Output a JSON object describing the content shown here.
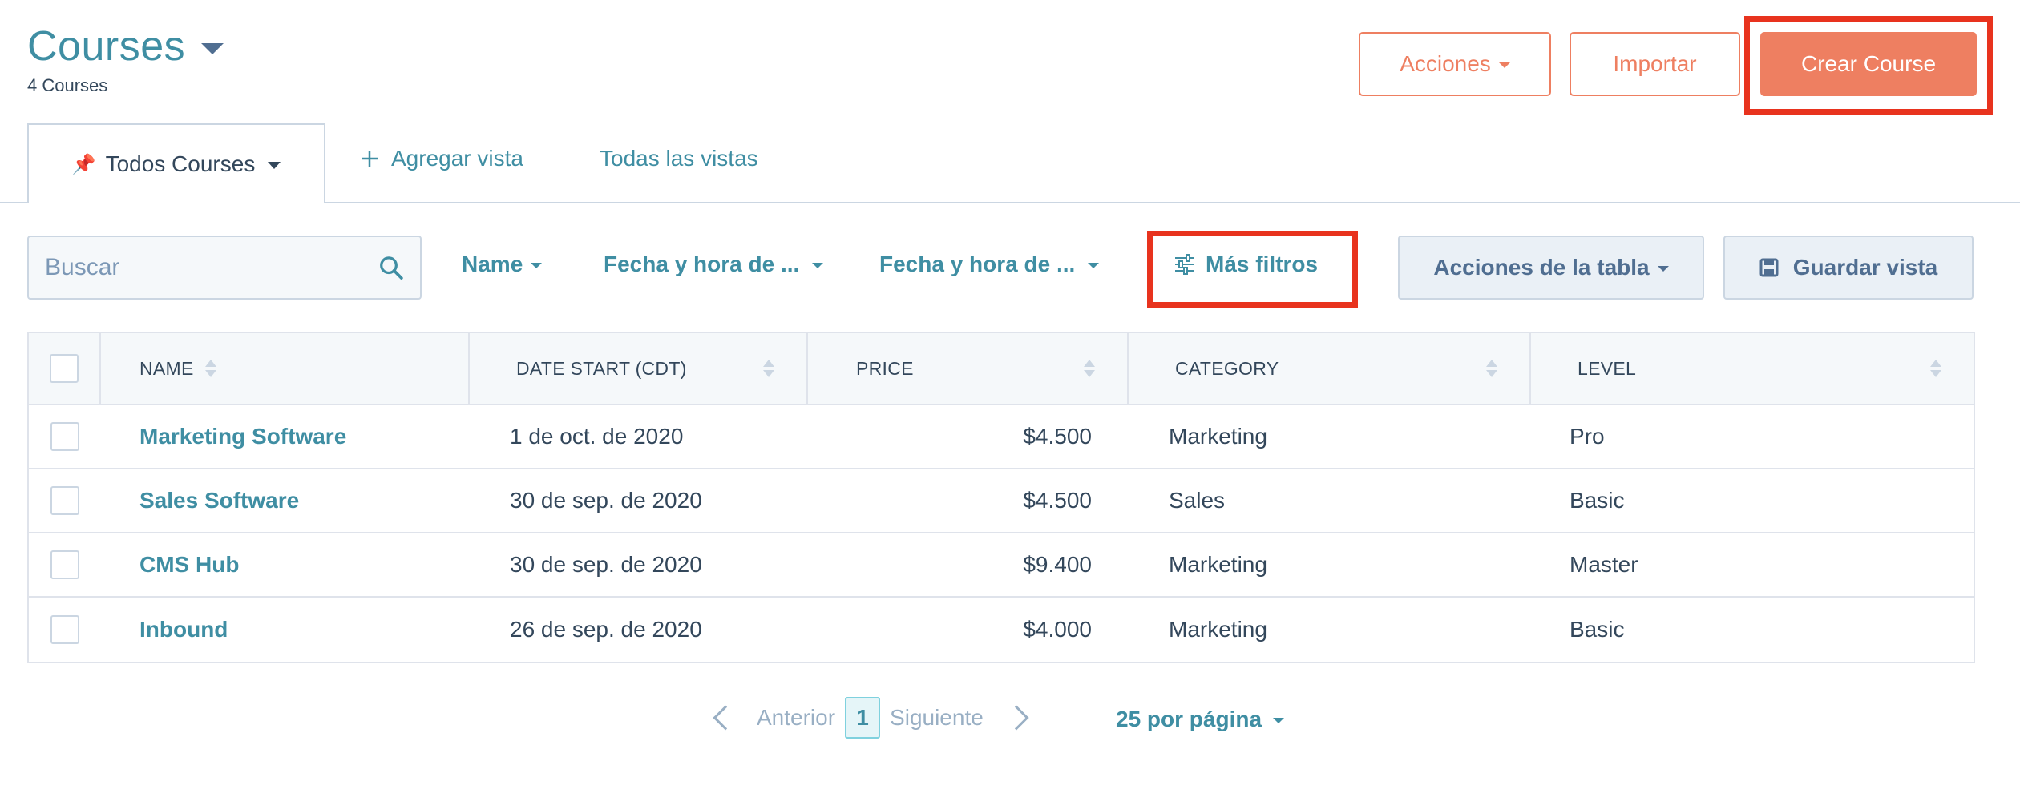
{
  "header": {
    "title": "Courses",
    "count_label": "4 Courses",
    "actions_label": "Acciones",
    "import_label": "Importar",
    "create_label": "Crear Course"
  },
  "tabs": {
    "active_label": "Todos Courses",
    "add_view_label": "Agregar vista",
    "all_views_label": "Todas las vistas"
  },
  "filters": {
    "search_placeholder": "Buscar",
    "name_filter": "Name",
    "date_filter_1": "Fecha y hora de ...",
    "date_filter_2": "Fecha y hora de ...",
    "more_filters": "Más filtros",
    "table_actions": "Acciones de la tabla",
    "save_view": "Guardar vista"
  },
  "table": {
    "columns": [
      "NAME",
      "DATE START (CDT)",
      "PRICE",
      "CATEGORY",
      "LEVEL"
    ],
    "rows": [
      {
        "name": "Marketing Software",
        "date": "1 de oct. de 2020",
        "price": "$4.500",
        "category": "Marketing",
        "level": "Pro"
      },
      {
        "name": "Sales Software",
        "date": "30 de sep. de 2020",
        "price": "$4.500",
        "category": "Sales",
        "level": "Basic"
      },
      {
        "name": "CMS Hub",
        "date": "30 de sep. de 2020",
        "price": "$9.400",
        "category": "Marketing",
        "level": "Master"
      },
      {
        "name": "Inbound",
        "date": "26 de sep. de 2020",
        "price": "$4.000",
        "category": "Marketing",
        "level": "Basic"
      }
    ]
  },
  "pagination": {
    "prev_label": "Anterior",
    "current_page": "1",
    "next_label": "Siguiente",
    "per_page_label": "25 por página"
  },
  "colors": {
    "accent": "#3f8ea3",
    "brand_orange": "#ee7f61",
    "highlight_red": "#e8331e",
    "text": "#33475b"
  },
  "icons": [
    "chevron-down-icon",
    "pin-icon",
    "plus-icon",
    "search-icon",
    "sliders-icon",
    "save-icon",
    "sort-icon",
    "chevron-left-icon",
    "chevron-right-icon"
  ]
}
